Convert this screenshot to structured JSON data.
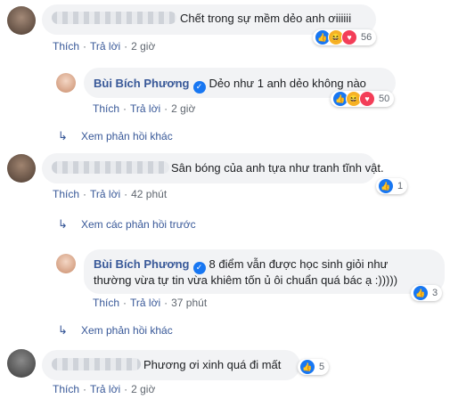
{
  "comments": [
    {
      "text": "Chết trong sự mềm dẻo anh ơiiiiii",
      "like": "Thích",
      "reply": "Trả lời",
      "time": "2 giờ",
      "reactions": "56"
    },
    {
      "name": "Bùi Bích Phương",
      "text": "Dẻo như 1 anh dẻo không nào",
      "like": "Thích",
      "reply": "Trả lời",
      "time": "2 giờ",
      "reactions": "50"
    },
    {
      "text": "Sân bóng của anh tựa như tranh tĩnh vật.",
      "like": "Thích",
      "reply": "Trả lời",
      "time": "42 phút",
      "reactions": "1"
    },
    {
      "name": "Bùi Bích Phương",
      "text1": "8 điểm vẫn được học sinh giỏi như",
      "text2": "thường vừa tự tin vừa khiêm tốn ủ ôi chuẩn quá bác ạ :)))))",
      "like": "Thích",
      "reply": "Trả lời",
      "time": "37 phút",
      "reactions": "3"
    },
    {
      "text": "Phương ơi xinh quá đi mất",
      "like": "Thích",
      "reply": "Trả lời",
      "time": "2 giờ",
      "reactions": "5"
    }
  ],
  "more_replies": "Xem phản hồi khác",
  "previous_replies": "Xem các phản hồi trước",
  "more_replies_2": "Xem phản hồi khác",
  "colors": {
    "link": "#385898",
    "like": "#1877f2",
    "love": "#f33e58",
    "haha": "#f7b125"
  }
}
